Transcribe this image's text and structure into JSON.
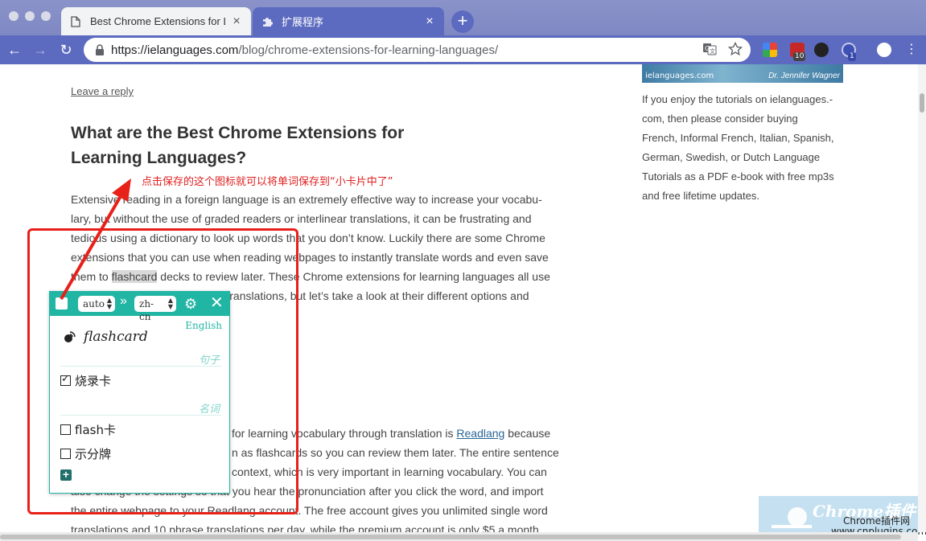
{
  "browser": {
    "tabs": [
      {
        "title": "Best Chrome Extensions for Le",
        "close": "×"
      },
      {
        "title": "扩展程序",
        "close": "×"
      }
    ],
    "new_tab": "+",
    "url": {
      "host": "https://ielanguages.com",
      "path": "/blog/chrome-extensions-for-learning-languages/"
    },
    "extension_badges": [
      "10",
      "1"
    ]
  },
  "page": {
    "leave_reply": "Leave a reply",
    "title_line1": "What are the Best Chrome Extensions for",
    "title_line2": "Learning Languages?",
    "annotation": "点击保存的这个图标就可以将单词保存到“小卡片中了”",
    "p1_lines": [
      "Extensive reading in a foreign language is an extremely effective way to increase your vocabu-",
      "lary, but without the use of graded readers or interlinear translations, it can be frustrating and",
      "tedious using a dictionary to look up words that you don’t know. Luckily there are some Chrome",
      "extensions that you can use when reading webpages to instantly translate words and even save"
    ],
    "p1_l5_a": "them to ",
    "p1_l5_hl": "flashcard",
    "p1_l5_b": " decks to review later. These Chrome extensions for learning languages all use",
    "p1_l6": "the translations, but let’s take a look at their different options and",
    "p2_l1_a": "for learning vocabulary through translation is ",
    "p2_l1_link": "Readlang",
    "p2_l1_b": " because",
    "p2_l2": "n as flashcards so you can review them later. The entire sentence",
    "p2_l3": "context, which is very important in learning vocabulary. You can",
    "p2_l4": "also change the settings so that you hear the pronunciation after you click the word, and import",
    "p2_l5": "the entire webpage to your Readlang account. The free account gives you unlimited single word",
    "p2_l6": "translations and 10 phrase translations per day, while the premium account is only $5 a month"
  },
  "sidebar": {
    "banner_left": "ielanguages.com",
    "banner_right": "Dr. Jennifer Wagner",
    "lines": [
      "If you enjoy the tutorials on ielanguages.-",
      "com, then please consider buying",
      "French, Informal French, Italian, Spanish,",
      "German, Swedish, or Dutch Language",
      "Tutorials as a PDF e-book with free mp3s",
      "and free lifetime updates."
    ]
  },
  "popup": {
    "source_lang": "auto",
    "target_lang": "zh-cn",
    "arrows": "»",
    "detected_language": "English",
    "word": "flashcard",
    "groups": [
      {
        "pos": "句子",
        "items": [
          {
            "text": "烧录卡",
            "checked": true
          }
        ]
      },
      {
        "pos": "名词",
        "items": [
          {
            "text": "flash卡",
            "checked": false
          },
          {
            "text": "示分牌",
            "checked": false
          }
        ]
      }
    ],
    "add": "+"
  },
  "watermark": {
    "logo": "Chrome插件",
    "sub": "Chrome插件网",
    "url": "www.cnplugins.com"
  },
  "colors": {
    "accent": "#21b5a4",
    "toolbar": "#5c6bc0",
    "annotation": "#e8201a"
  }
}
